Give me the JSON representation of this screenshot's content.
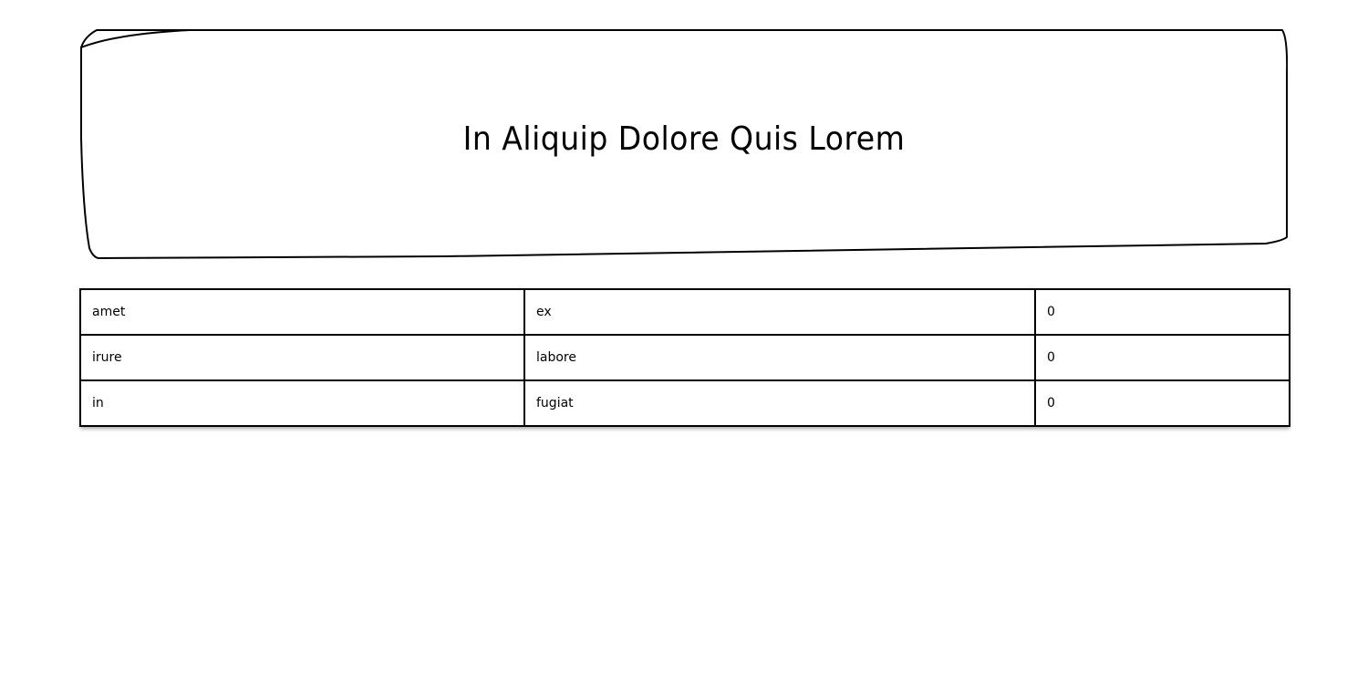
{
  "header": {
    "title": "In Aliquip Dolore Quis Lorem"
  },
  "table": {
    "rows": [
      [
        "amet",
        "ex",
        "0"
      ],
      [
        "irure",
        "labore",
        "0"
      ],
      [
        "in",
        "fugiat",
        "0"
      ]
    ]
  }
}
